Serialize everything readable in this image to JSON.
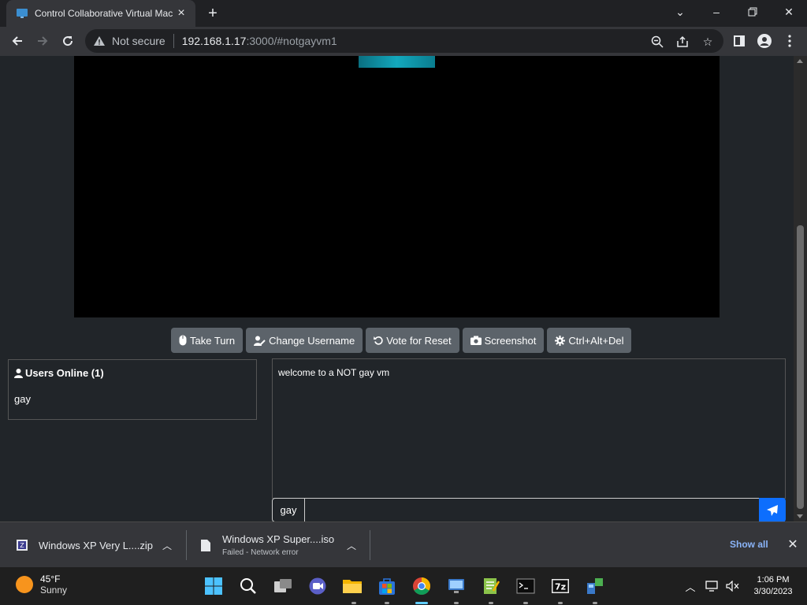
{
  "browser": {
    "tab_title": "Control Collaborative Virtual Machine",
    "new_tab": "+",
    "security_label": "Not secure",
    "url_host": "192.168.1.17",
    "url_rest": ":3000/#notgayvm1"
  },
  "vm_controls": {
    "take_turn": "Take Turn",
    "change_username": "Change Username",
    "vote_reset": "Vote for Reset",
    "screenshot": "Screenshot",
    "ctrl_alt_del": "Ctrl+Alt+Del"
  },
  "users_panel": {
    "heading": "Users Online (1)",
    "users": [
      "gay"
    ]
  },
  "chat": {
    "messages": [
      "welcome to a NOT gay vm"
    ],
    "username": "gay",
    "input_value": ""
  },
  "downloads": {
    "items": [
      {
        "name": "Windows XP Very L....zip",
        "status": ""
      },
      {
        "name": "Windows XP Super....iso",
        "status": "Failed - Network error"
      }
    ],
    "show_all": "Show all"
  },
  "taskbar": {
    "weather_temp": "45°F",
    "weather_condition": "Sunny",
    "time": "1:06 PM",
    "date": "3/30/2023"
  },
  "colors": {
    "accent": "#0d6efd",
    "page_bg": "#212529",
    "button_bg": "#5c636a"
  }
}
